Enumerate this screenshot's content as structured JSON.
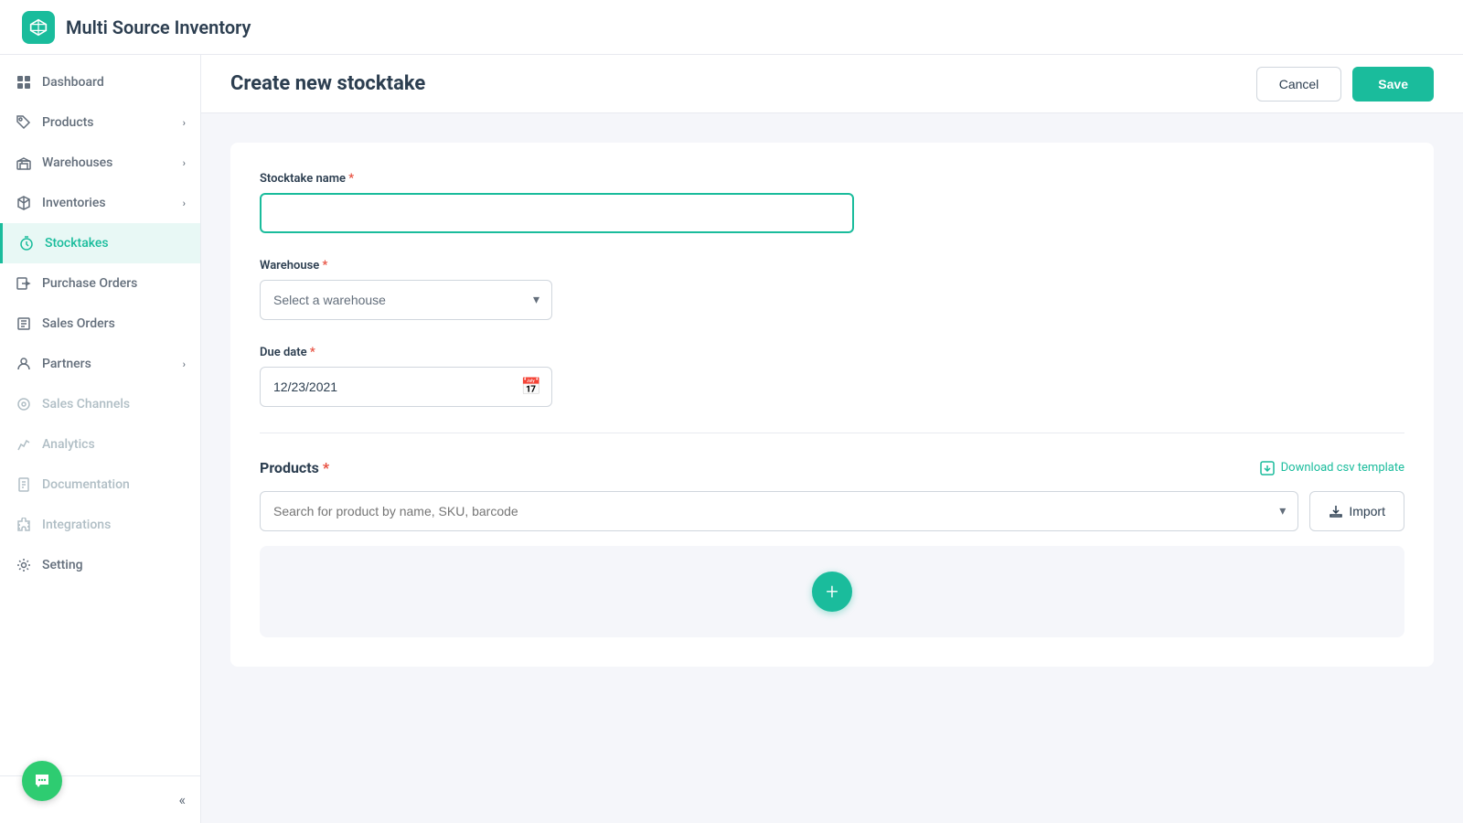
{
  "app": {
    "title": "Multi Source Inventory"
  },
  "sidebar": {
    "items": [
      {
        "id": "dashboard",
        "label": "Dashboard",
        "icon": "grid-icon",
        "hasChevron": false,
        "active": false,
        "disabled": false
      },
      {
        "id": "products",
        "label": "Products",
        "icon": "tag-icon",
        "hasChevron": true,
        "active": false,
        "disabled": false
      },
      {
        "id": "warehouses",
        "label": "Warehouses",
        "icon": "building-icon",
        "hasChevron": true,
        "active": false,
        "disabled": false
      },
      {
        "id": "inventories",
        "label": "Inventories",
        "icon": "box-icon",
        "hasChevron": true,
        "active": false,
        "disabled": false
      },
      {
        "id": "stocktakes",
        "label": "Stocktakes",
        "icon": "clock-icon",
        "hasChevron": false,
        "active": true,
        "disabled": false
      },
      {
        "id": "purchase-orders",
        "label": "Purchase Orders",
        "icon": "login-icon",
        "hasChevron": false,
        "active": false,
        "disabled": false
      },
      {
        "id": "sales-orders",
        "label": "Sales Orders",
        "icon": "list-icon",
        "hasChevron": false,
        "active": false,
        "disabled": false
      },
      {
        "id": "partners",
        "label": "Partners",
        "icon": "user-icon",
        "hasChevron": true,
        "active": false,
        "disabled": false
      },
      {
        "id": "sales-channels",
        "label": "Sales Channels",
        "icon": "circle-icon",
        "hasChevron": false,
        "active": false,
        "disabled": true
      },
      {
        "id": "analytics",
        "label": "Analytics",
        "icon": "chart-icon",
        "hasChevron": false,
        "active": false,
        "disabled": true
      },
      {
        "id": "documentation",
        "label": "Documentation",
        "icon": "doc-icon",
        "hasChevron": false,
        "active": false,
        "disabled": true
      },
      {
        "id": "integrations",
        "label": "Integrations",
        "icon": "puzzle-icon",
        "hasChevron": false,
        "active": false,
        "disabled": true
      },
      {
        "id": "setting",
        "label": "Setting",
        "icon": "gear-icon",
        "hasChevron": false,
        "active": false,
        "disabled": false
      }
    ],
    "collapse_label": "«"
  },
  "page": {
    "title": "Create new stocktake",
    "cancel_label": "Cancel",
    "save_label": "Save"
  },
  "form": {
    "stocktake_name": {
      "label": "Stocktake name",
      "required": true,
      "placeholder": "",
      "value": ""
    },
    "warehouse": {
      "label": "Warehouse",
      "required": true,
      "placeholder": "Select a warehouse",
      "options": [
        "Select a warehouse"
      ]
    },
    "due_date": {
      "label": "Due date",
      "required": true,
      "value": "12/23/2021"
    },
    "products": {
      "label": "Products",
      "required": true,
      "search_placeholder": "Search for product by name, SKU, barcode",
      "download_csv_label": "Download csv template",
      "import_label": "Import"
    }
  }
}
